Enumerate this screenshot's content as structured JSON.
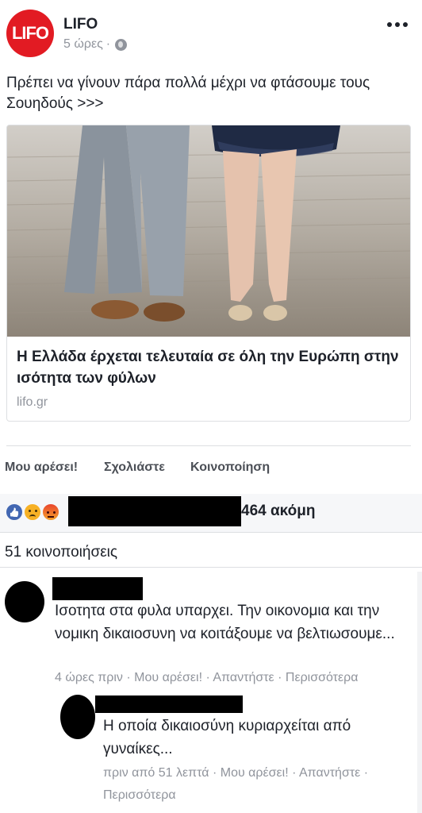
{
  "post": {
    "page_name": "LIFO",
    "logo_text": "LIFO",
    "time": "5 ώρες",
    "meta_separator": "·",
    "text": "Πρέπει να γίνουν πάρα πολλά μέχρι να φτάσουμε τους Σουηδούς >>>",
    "icons": {
      "privacy": "globe-icon",
      "more": "more-options-icon"
    }
  },
  "link_card": {
    "title": "Η Ελλάδα έρχεται τελευταία σε όλη την Ευρώπη στην ισότητα των φύλων",
    "domain": "lifo.gr"
  },
  "actions": {
    "like": "Μου αρέσει!",
    "comment": "Σχολιάστε",
    "share": "Κοινοποίηση"
  },
  "reactions": {
    "count_text": "464 ακόμη",
    "icons": [
      "like-reaction-icon",
      "sad-reaction-icon",
      "angry-reaction-icon"
    ]
  },
  "shares": {
    "text": "51 κοινοποιήσεις"
  },
  "comments": [
    {
      "text": "Ισοτητα στα φυλα υπαρχει. Την οικονομια και την νομικη δικαιοσυνη να κοιτάξουμε να βελτιωσουμε...",
      "meta": "4 ώρες πριν · Μου αρέσει! · Απαντήστε · Περισσότερα"
    },
    {
      "text": "Η οποία δικαιοσύνη κυριαρχείται από γυναίκες...",
      "meta": "πριν από 51 λεπτά · Μου αρέσει! · Απαντήστε · Περισσότερα"
    }
  ],
  "colors": {
    "brand_red": "#e21b23",
    "text_primary": "#1d2129",
    "text_secondary": "#90949c",
    "facebook_blue": "#4267b2"
  }
}
